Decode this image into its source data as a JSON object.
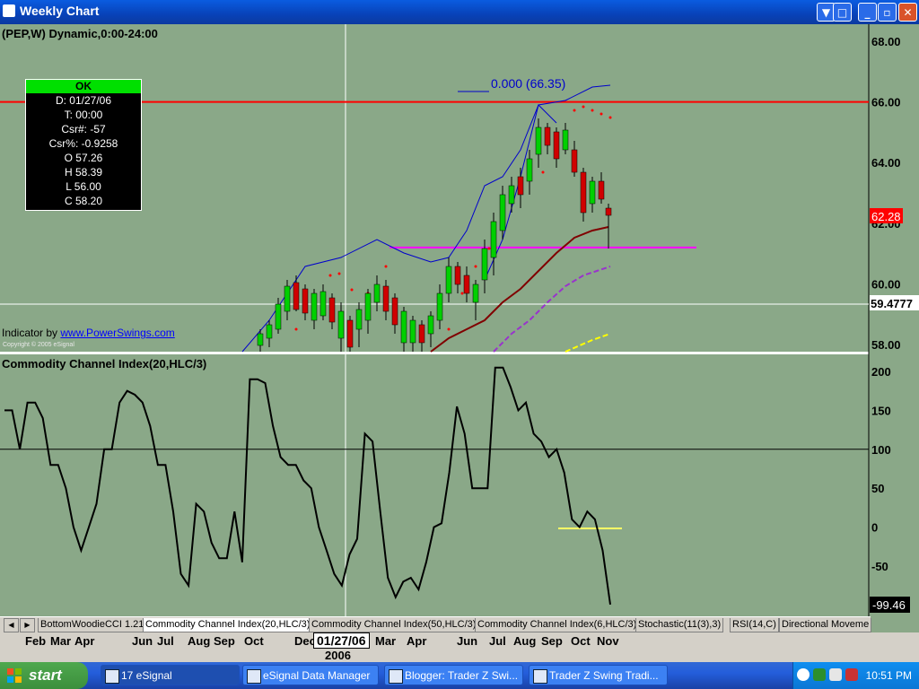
{
  "window": {
    "title": "Weekly Chart",
    "buttons": {
      "scroll": "▼",
      "restore_window": "□",
      "minimize": "_",
      "maximize": "▫",
      "close": "✕"
    }
  },
  "price_panel": {
    "symbol_label": "(PEP,W) Dynamic,0:00-24:00",
    "cursor_box": {
      "status": "OK",
      "date": "D: 01/27/06",
      "time": "T: 00:00",
      "csr_num": "Csr#: -57",
      "csr_pct": "Csr%: -0.9258",
      "open": "O 57.26",
      "high": "H 58.39",
      "low": "L 56.00",
      "close": "C 58.20"
    },
    "fib_label": "0.000 (66.35)",
    "indicator_credit": "Indicator by",
    "indicator_link": "www.PowerSwings.com",
    "copyright": "Copyright © 2005 eSignal",
    "y_ticks": [
      "68.00",
      "66.00",
      "64.00",
      "62.00",
      "60.00",
      "58.00"
    ],
    "last_price_badge": "62.28",
    "cursor_price_badge": "59.4777",
    "hline_price": 66.0,
    "support_price": 61.2,
    "colors": {
      "resistance": "#ff0000",
      "support": "#ff00ff",
      "bull": "#00d000",
      "bear": "#d00000",
      "upper_band": "#0000cc",
      "ma_slow": "#800000",
      "ma_mid": "#9933cc",
      "ma_long": "#ffff00",
      "sar": "#ff0000"
    }
  },
  "cci_panel": {
    "title": "Commodity Channel Index(20,HLC/3)",
    "y_ticks": [
      "200",
      "150",
      "100",
      "50",
      "0",
      "-50"
    ],
    "last_value_badge": "-99.46",
    "reference_level": 100
  },
  "chart_data": {
    "type": "line",
    "title": "Commodity Channel Index(20,HLC/3)",
    "ylim": [
      -100,
      210
    ],
    "values": [
      150,
      150,
      100,
      160,
      160,
      140,
      80,
      80,
      50,
      0,
      -30,
      0,
      30,
      100,
      100,
      160,
      175,
      170,
      160,
      130,
      80,
      80,
      20,
      -60,
      -75,
      30,
      20,
      -20,
      -40,
      -40,
      20,
      -45,
      190,
      190,
      185,
      130,
      90,
      80,
      80,
      60,
      50,
      0,
      -30,
      -60,
      -75,
      -35,
      -15,
      120,
      110,
      20,
      -65,
      -90,
      -70,
      -65,
      -80,
      -45,
      0,
      5,
      70,
      155,
      120,
      50,
      50,
      50,
      205,
      205,
      180,
      150,
      160,
      120,
      110,
      90,
      100,
      70,
      10,
      0,
      20,
      10,
      -30,
      -99.46
    ]
  },
  "tabs": [
    "BottomWoodieCCI 1.21",
    "Commodity Channel Index(20,HLC/3)",
    "Commodity Channel Index(50,HLC/3)",
    "Commodity Channel Index(6,HLC/3)",
    "Stochastic(11(3),3)",
    "RSI(14,C)",
    "Directional Moveme"
  ],
  "tab_nav": {
    "prev": "◀",
    "next": "▶"
  },
  "date_axis": {
    "labels": [
      "Feb",
      "Mar",
      "Apr",
      "Jun",
      "Jul",
      "Aug",
      "Sep",
      "Oct",
      "Dec",
      "Mar",
      "Apr",
      "Jun",
      "Jul",
      "Aug",
      "Sep",
      "Oct",
      "Nov"
    ],
    "cursor_date": "01/27/06",
    "year": "2006"
  },
  "taskbar": {
    "start": "start",
    "items": [
      {
        "label": "17 eSignal",
        "count": "17"
      },
      {
        "label": "eSignal Data Manager"
      },
      {
        "label": "Blogger: Trader Z Swi..."
      },
      {
        "label": "Trader Z Swing Tradi..."
      }
    ],
    "clock": "10:51 PM"
  }
}
